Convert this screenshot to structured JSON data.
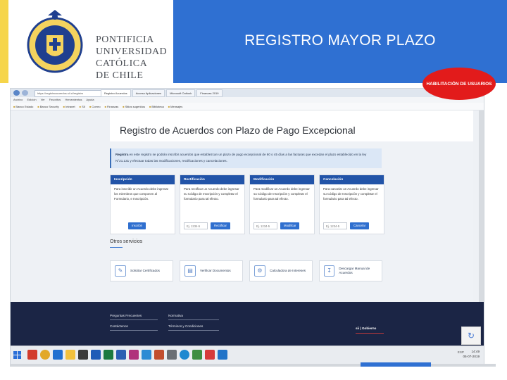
{
  "slide": {
    "title": "REGISTRO MAYOR PLAZO",
    "badge": "HABILITACIÓN DE USUARIOS",
    "logo_lines": [
      "PONTIFICIA",
      "UNIVERSIDAD",
      "CATÓLICA",
      "DE CHILE"
    ]
  },
  "browser": {
    "url": "https://registroacuerdos.sii.cl/registro",
    "tabs": [
      "Registro Acuerdos",
      "Acceso Aplicaciones",
      "Microsoft Outlook",
      "Finanzas 2019"
    ],
    "menu": [
      "Archivo",
      "Edición",
      "Ver",
      "Favoritos",
      "Herramientas",
      "Ayuda"
    ],
    "bookmarks": [
      "Banco Estado",
      "Banco Security",
      "Intranet",
      "SII",
      "Correo",
      "Finanzas",
      "Sitios sugeridos",
      "Biblioteca",
      "Mensajes"
    ]
  },
  "page": {
    "title": "Registro de Acuerdos con Plazo de Pago Excepcional",
    "notice_lead": "Registra",
    "notice_text": "en este registro se podrán inscribir acuerdos que establezcan un plazo de pago excepcional de 60 o 45 días a las facturas que excedan el plazo establecido en la ley N°21.131 y efectuar todas las modificaciones, rectificaciones y cancelaciones.",
    "cards": [
      {
        "header": "Inscripción",
        "text": "Para inscribir un Acuerdo debe ingresar los miembros que componen al Formulario, e Inscripción.",
        "input": "",
        "button": "Inscribir"
      },
      {
        "header": "Rectificación",
        "text": "Para rectificar un Acuerdo debe ingresar su Código de Inscripción y completar el formulario para tal efecto.",
        "input": "Ej. 1234-5",
        "button": "Rectificar"
      },
      {
        "header": "Modificación",
        "text": "Para modificar un Acuerdo debe ingresar su Código de Inscripción y completar el formulario para tal efecto.",
        "input": "Ej. 1234-5",
        "button": "Modificar"
      },
      {
        "header": "Cancelación",
        "text": "Para cancelar un Acuerdo debe ingresar su Código de Inscripción y completar el formulario para tal efecto.",
        "input": "Ej. 1234-5",
        "button": "Cancelar"
      }
    ],
    "others_title": "Otros servicios",
    "services": [
      {
        "label": "Solicitar Certificados"
      },
      {
        "label": "Verificar Documentos"
      },
      {
        "label": "Calculadora de Intereses"
      },
      {
        "label": "Descargar Manual de Acuerdos"
      }
    ],
    "footer": {
      "links": [
        "Preguntas Frecuentes",
        "Contáctenos",
        "Normativa",
        "Términos y Condiciones"
      ],
      "logo": "sii | Gobierno"
    }
  },
  "taskbar": {
    "tray_lang": "ESP",
    "time": "14:49",
    "date": "05-07-2019"
  }
}
